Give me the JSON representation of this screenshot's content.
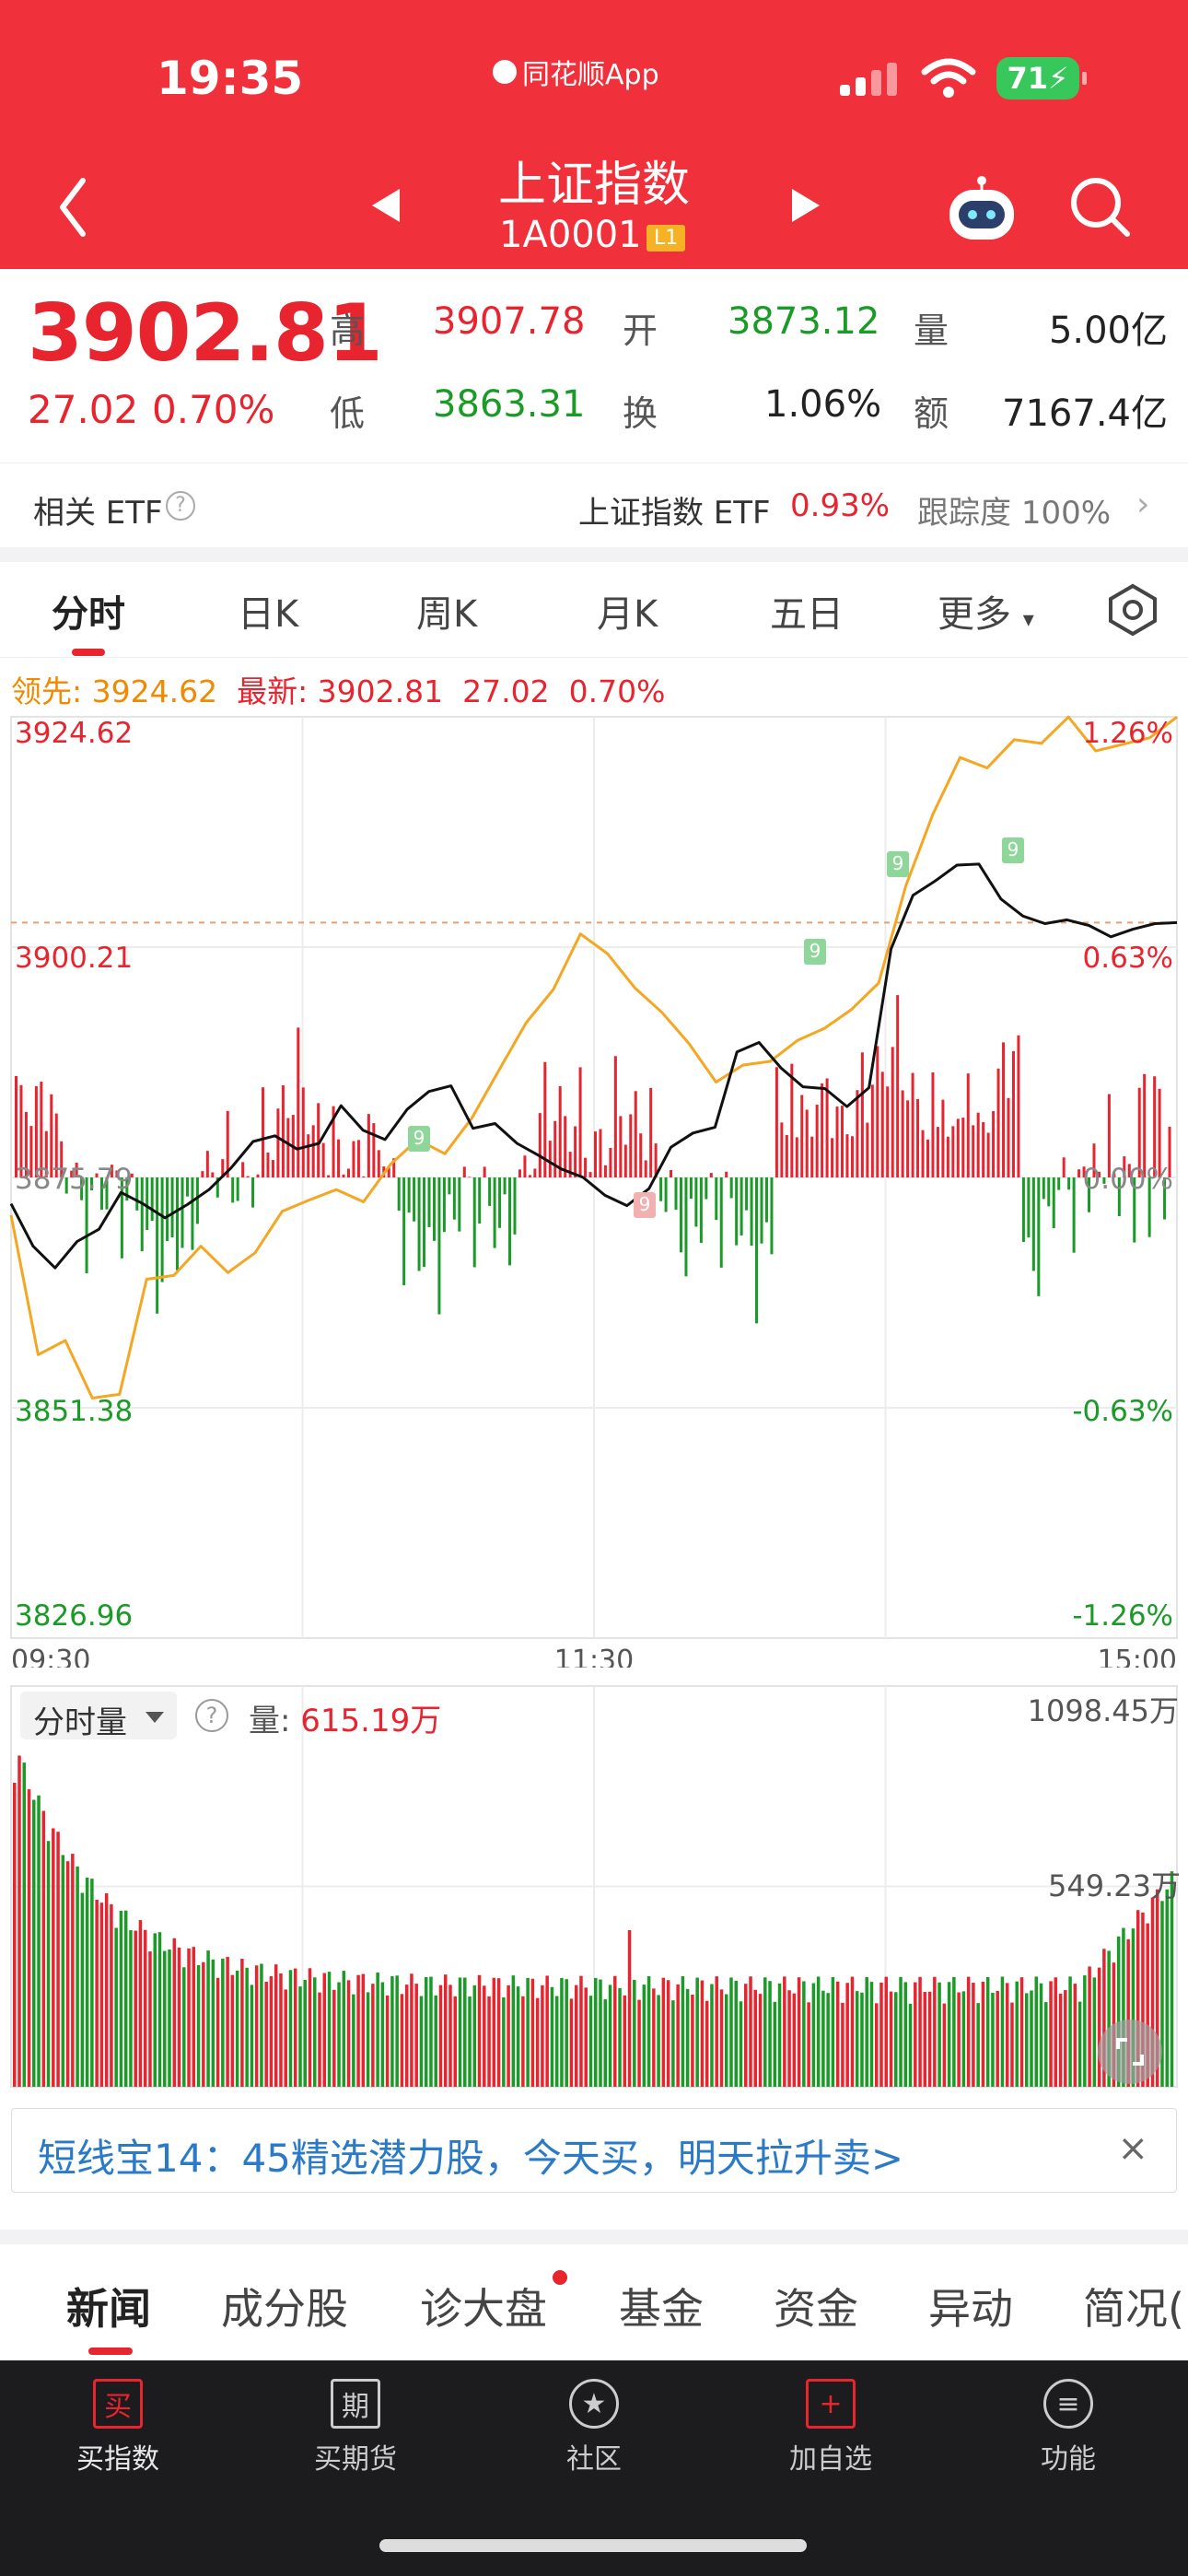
{
  "status_bar": {
    "time": "19:35",
    "app_name": "同花顺App",
    "battery": "71"
  },
  "header": {
    "title": "上证指数",
    "code": "1A0001",
    "level_badge": "L1"
  },
  "quote": {
    "last": "3902.81",
    "change": "27.02",
    "change_pct": "0.70%",
    "high_label": "高",
    "high": "3907.78",
    "open_label": "开",
    "open": "3873.12",
    "vol_label": "量",
    "vol": "5.00亿",
    "low_label": "低",
    "low": "3863.31",
    "turnover_label": "换",
    "turnover": "1.06%",
    "amount_label": "额",
    "amount": "7167.4亿"
  },
  "etf_bar": {
    "label": "相关 ETF",
    "help": "?",
    "etf_name": "上证指数 ETF",
    "etf_pct": "0.93%",
    "track_label": "跟踪度",
    "track": "100%",
    "chevron": "›"
  },
  "chart_tabs": [
    "分时",
    "日K",
    "周K",
    "月K",
    "五日",
    "更多"
  ],
  "info_line": {
    "lead_label": "领先: ",
    "lead_value": "3924.62",
    "latest_label": "最新: ",
    "latest_value": "3902.81",
    "change": "27.02",
    "pct": "0.70%"
  },
  "chart_data": {
    "type": "line",
    "x_ticks": [
      "09:30",
      "11:30",
      "15:00"
    ],
    "y_labels_left": [
      "3924.62",
      "3900.21",
      "3875.79",
      "3851.38",
      "3826.96"
    ],
    "y_labels_right": [
      "1.26%",
      "0.63%",
      "0.00%",
      "-0.63%",
      "-1.26%"
    ],
    "ylim": [
      3826.96,
      3924.62
    ],
    "prev_close": 3875.79,
    "series": [
      {
        "values": [
          3873.0,
          3868.5,
          3866.2,
          3869.0,
          3870.3,
          3874.2,
          3873.0,
          3871.5,
          3872.9,
          3874.5,
          3876.8,
          3879.6,
          3880.2,
          3878.8,
          3879.4,
          3883.4,
          3880.8,
          3879.8,
          3883.0,
          3884.9,
          3885.5,
          3881.0,
          3881.5,
          3879.4,
          3878.1,
          3876.7,
          3875.8,
          3873.9,
          3872.8,
          3874.6,
          3879.0,
          3880.5,
          3881.1,
          3889.1,
          3890.1,
          3887.4,
          3885.4,
          3885.2,
          3883.3,
          3885.3,
          3900.0,
          3905.7,
          3907.2,
          3908.9,
          3909.0,
          3905.3,
          3903.5,
          3902.7,
          3903.1,
          3902.5,
          3901.3,
          3902.1,
          3902.7,
          3902.8
        ]
      },
      {
        "values": [
          3871.8,
          3857.0,
          3858.5,
          3852.4,
          3852.8,
          3865.0,
          3865.4,
          3868.5,
          3865.7,
          3867.8,
          3872.2,
          3873.4,
          3874.5,
          3873.2,
          3877.2,
          3879.8,
          3878.3,
          3882.1,
          3887.2,
          3892.2,
          3895.7,
          3901.6,
          3899.5,
          3895.9,
          3893.3,
          3890.0,
          3885.9,
          3887.7,
          3888.1,
          3890.3,
          3891.6,
          3893.6,
          3896.4,
          3906.7,
          3914.3,
          3920.3,
          3919.2,
          3922.2,
          3921.8,
          3924.6,
          3921.0,
          3921.7,
          3922.4,
          3924.6
        ]
      }
    ],
    "markers": [
      "9",
      "9",
      "9",
      "9",
      "9"
    ]
  },
  "volume_panel": {
    "selector": "分时量",
    "help": "?",
    "vol_label": "量: ",
    "vol_value": "615.19万",
    "max_label": "1098.45万",
    "mid_label": "549.23万"
  },
  "banner": {
    "text": "短线宝14：45精选潜力股，今天买，明天拉升卖>",
    "close": "×"
  },
  "news_tabs": [
    "新闻",
    "成分股",
    "诊大盘",
    "基金",
    "资金",
    "异动",
    "简况("
  ],
  "bottom_nav": [
    {
      "icon": "买",
      "label": "买指数"
    },
    {
      "icon": "期",
      "label": "买期货"
    },
    {
      "icon": "★",
      "label": "社区"
    },
    {
      "icon": "+",
      "label": "加自选"
    },
    {
      "icon": "≡",
      "label": "功能"
    }
  ],
  "colors": {
    "header": "#f0303a",
    "up": "#e8242f",
    "down": "#1a9a26",
    "lead_line": "#f5a623"
  }
}
